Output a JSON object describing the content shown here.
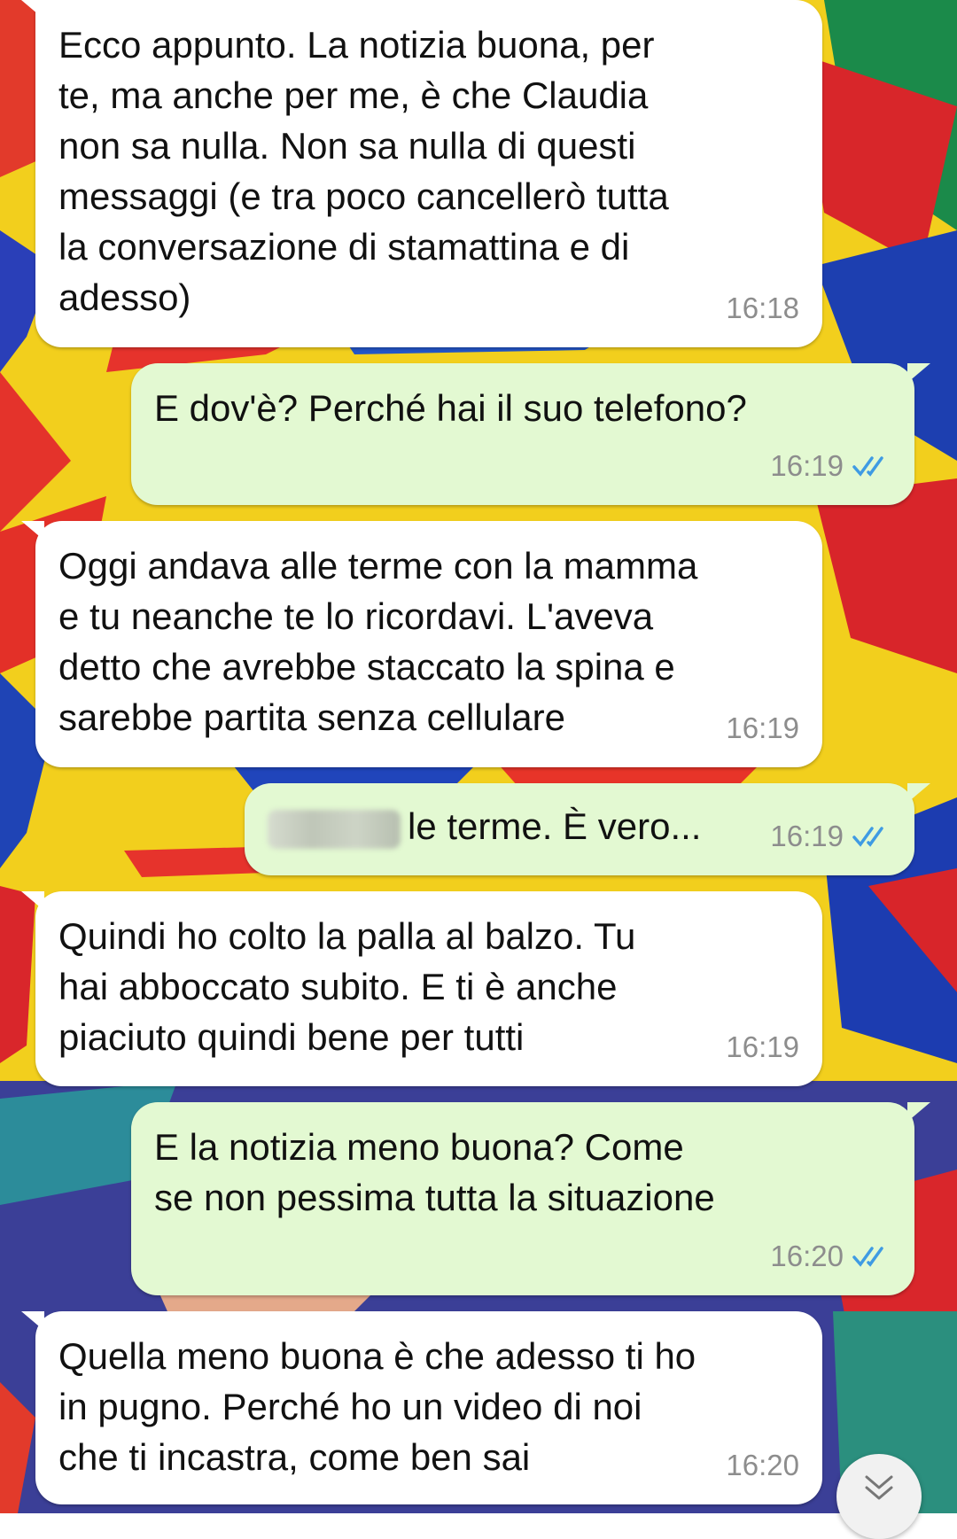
{
  "messages": [
    {
      "direction": "incoming",
      "text": "Ecco appunto. La notizia buona, per\nte, ma anche per me, è che Claudia\nnon sa nulla. Non sa nulla di questi\nmessaggi (e tra poco cancellerò tutta\nla conversazione di stamattina e di\nadesso)",
      "time": "16:18"
    },
    {
      "direction": "outgoing",
      "text": "E dov'è? Perché hai il suo telefono?",
      "time": "16:19",
      "status": "read"
    },
    {
      "direction": "incoming",
      "text": "Oggi andava alle terme con la mamma\ne tu neanche te lo ricordavi. L'aveva\ndetto che avrebbe staccato la spina e\nsarebbe partita senza cellulare",
      "time": "16:19"
    },
    {
      "direction": "outgoing",
      "text": "le terme. È vero...",
      "time": "16:19",
      "status": "read",
      "redacted_prefix": true
    },
    {
      "direction": "incoming",
      "text": "Quindi ho colto la palla al balzo. Tu\nhai abboccato subito. E ti è anche\npiaciuto quindi bene per tutti",
      "time": "16:19"
    },
    {
      "direction": "outgoing",
      "text": "E la notizia meno buona? Come\nse non pessima tutta la situazione",
      "time": "16:20",
      "status": "read"
    },
    {
      "direction": "incoming",
      "text": "Quella meno buona è che adesso ti ho\nin pugno. Perché ho un video di noi\nche ti incastra, come ben sai",
      "time": "16:20"
    }
  ],
  "icons": {
    "read_receipt": "double-check-icon",
    "scroll_down": "chevron-double-down-icon"
  },
  "colors": {
    "incoming_bubble": "#ffffff",
    "outgoing_bubble": "#e3f9d2",
    "read_tick": "#3f9be3",
    "timestamp": "#8d8d8d"
  }
}
